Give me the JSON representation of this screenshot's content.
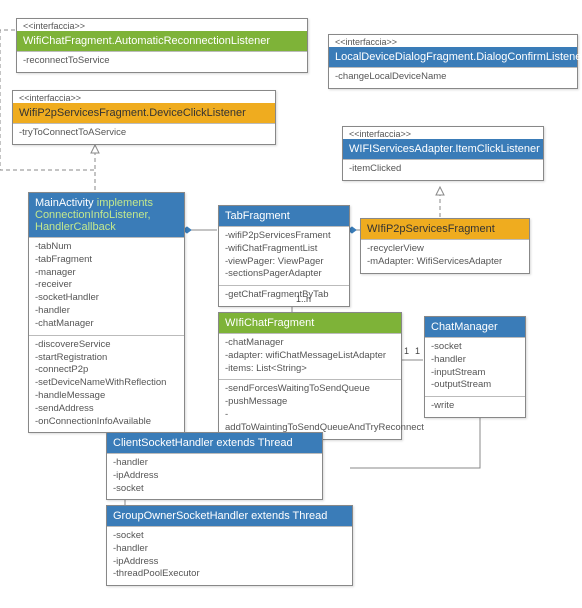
{
  "stereotype": "<<interfaccia>>",
  "classes": {
    "wifiChatAutoReconnect": {
      "title": "WifiChatFragment.AutomaticReconnectionListener",
      "ops": [
        "-reconnectToService"
      ]
    },
    "localDeviceDialog": {
      "title": "LocalDeviceDialogFragment.DialogConfirmListener",
      "ops": [
        "-changeLocalDeviceName"
      ]
    },
    "deviceClick": {
      "title": "WifiP2pServicesFragment.DeviceClickListener",
      "ops": [
        "-tryToConnectToAService"
      ]
    },
    "servicesAdapterItemClick": {
      "title": "WIFIServicesAdapter.ItemClickListener",
      "ops": [
        "-itemClicked"
      ]
    },
    "mainActivity": {
      "title": "MainActivity",
      "titleSuffix": "implements ConnectionInfoListener, HandlerCallback",
      "attrs": [
        "-tabNum",
        "-tabFragment",
        "-manager",
        "-receiver",
        "-socketHandler",
        "-handler",
        "-chatManager"
      ],
      "ops": [
        "-discovereService",
        "-startRegistration",
        "-connectP2p",
        "-setDeviceNameWithReflection",
        "-handleMessage",
        "-sendAddress",
        "-onConnectionInfoAvailable"
      ]
    },
    "tabFragment": {
      "title": "TabFragment",
      "attrs": [
        "-wifiP2pServicesFrament",
        "-wifiChatFragmentList",
        "-viewPager: ViewPager",
        "-sectionsPagerAdapter"
      ],
      "ops": [
        "-getChatFragmentByTab"
      ]
    },
    "wifiP2pServicesFragment": {
      "title": "WIfiP2pServicesFragment",
      "attrs": [
        "-recyclerView",
        "-mAdapter: WifiServicesAdapter"
      ]
    },
    "wifiChatFragment": {
      "title": "WIfiChatFragment",
      "attrs": [
        "-chatManager",
        "-adapter: wifiChatMessageListAdapter",
        "-items: List<String>"
      ],
      "ops": [
        "-sendForcesWaitingToSendQueue",
        "-pushMessage",
        "-addToWaintingToSendQueueAndTryReconnect"
      ]
    },
    "chatManager": {
      "title": "ChatManager",
      "attrs": [
        "-socket",
        "-handler",
        "-inputStream",
        "-outputStream"
      ],
      "ops": [
        "-write"
      ]
    },
    "clientSocketHandler": {
      "title": "ClientSocketHandler extends Thread",
      "attrs": [
        "-handler",
        "-ipAddress",
        "-socket"
      ]
    },
    "groupOwnerSocketHandler": {
      "title": "GroupOwnerSocketHandler extends Thread",
      "attrs": [
        "-socket",
        "-handler",
        "-ipAddress",
        "-threadPoolExecutor"
      ]
    }
  },
  "multiplicity": {
    "one": "1",
    "many": "1..n"
  }
}
